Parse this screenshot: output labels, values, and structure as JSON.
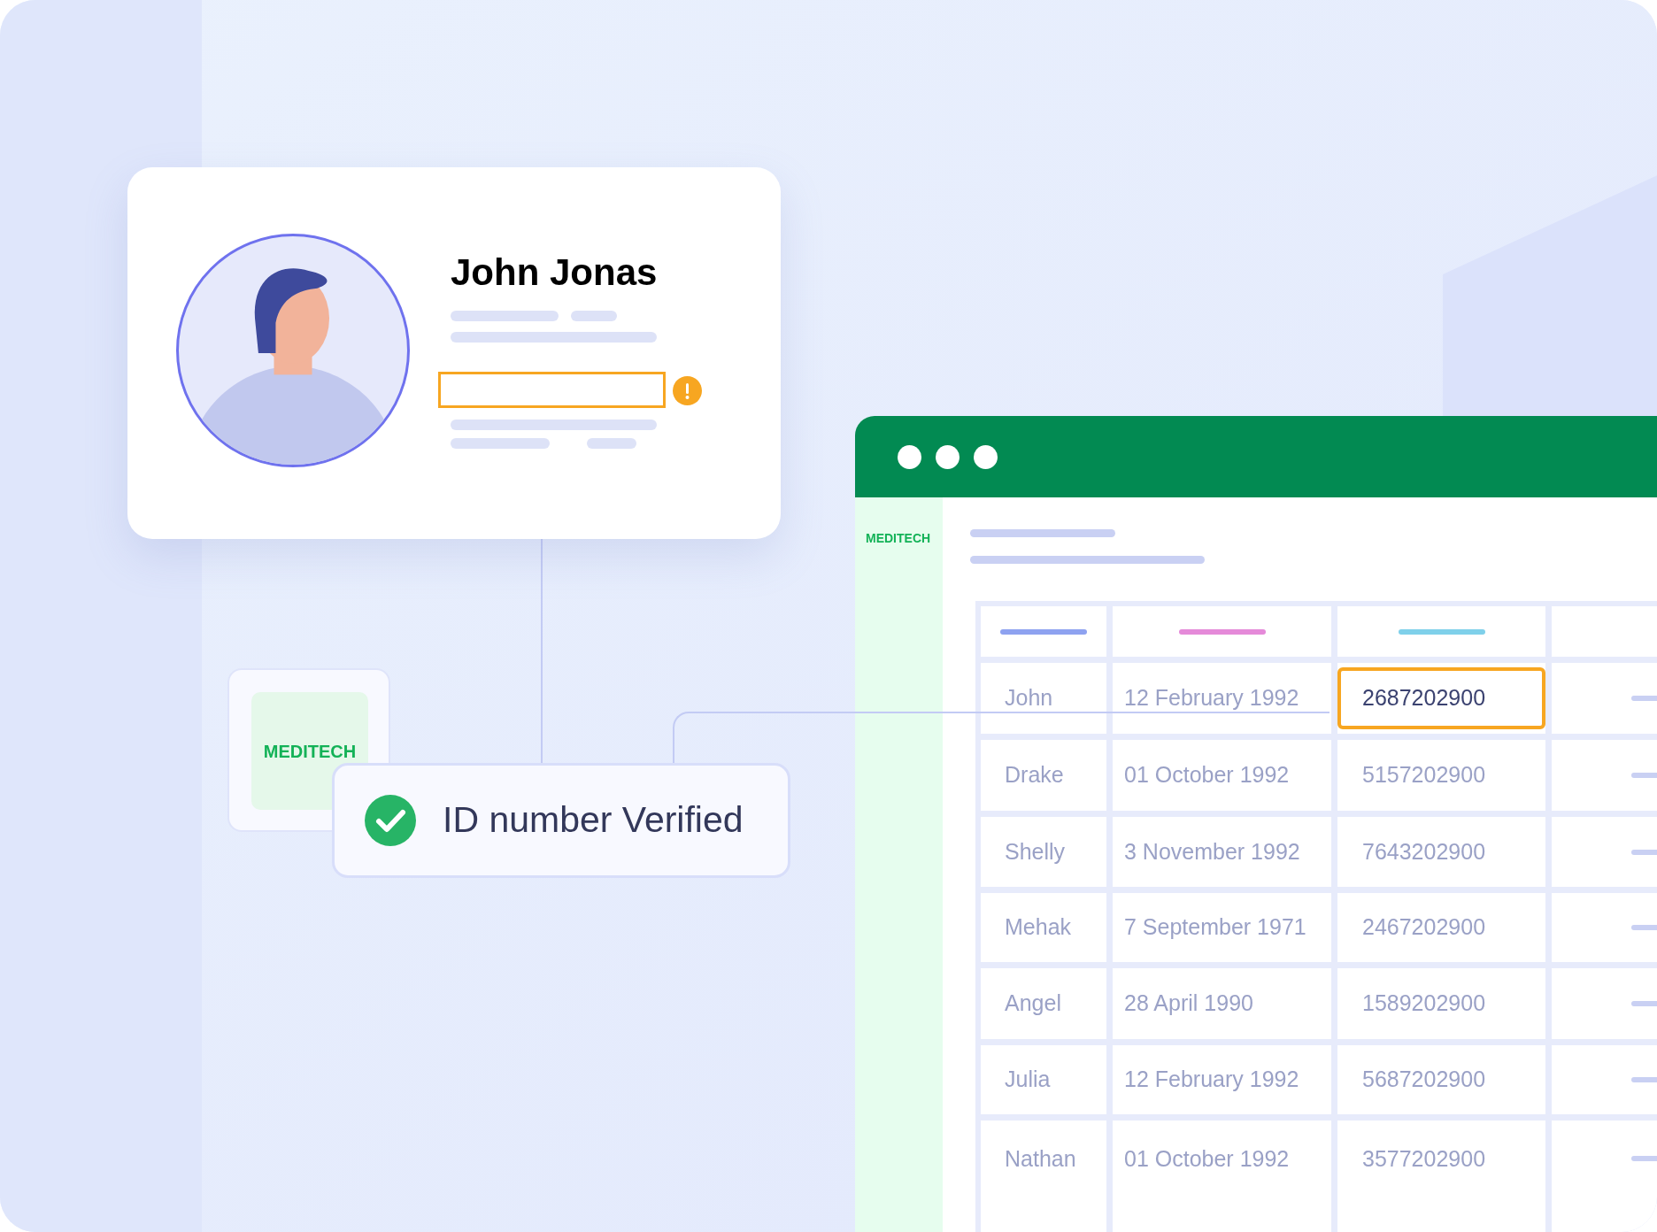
{
  "profile": {
    "name": "John Jonas",
    "field": {
      "warning": true
    }
  },
  "logo_card": {
    "label": "MEDITECH"
  },
  "verification": {
    "text": "ID number Verified",
    "verified": true
  },
  "app_window": {
    "sidebar": {
      "logo": "MEDITECH"
    },
    "table": {
      "columns": [
        {
          "color": "#8ea2f0"
        },
        {
          "color": "#e58ad9"
        },
        {
          "color": "#7fd0ea"
        }
      ],
      "rows": [
        {
          "name": "John",
          "date": "12 February 1992",
          "id": "2687202900",
          "selected": true
        },
        {
          "name": "Drake",
          "date": "01 October 1992",
          "id": "5157202900",
          "selected": false
        },
        {
          "name": "Shelly",
          "date": "3 November 1992",
          "id": "7643202900",
          "selected": false
        },
        {
          "name": "Mehak",
          "date": "7 September 1971",
          "id": "2467202900",
          "selected": false
        },
        {
          "name": "Angel",
          "date": "28 April 1990",
          "id": "1589202900",
          "selected": false
        },
        {
          "name": "Julia",
          "date": "12 February 1992",
          "id": "5687202900",
          "selected": false
        },
        {
          "name": "Nathan",
          "date": "01 October 1992",
          "id": "3577202900",
          "selected": false
        }
      ]
    }
  }
}
